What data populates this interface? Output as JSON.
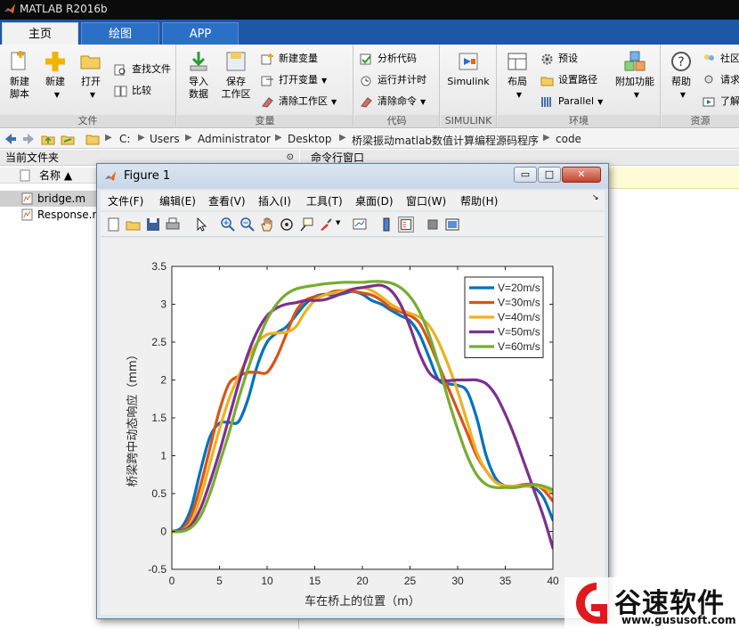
{
  "app": {
    "title": "MATLAB R2016b",
    "accent": "#1c57a8"
  },
  "tabs": [
    {
      "label": "主页",
      "active": true
    },
    {
      "label": "绘图",
      "active": false
    },
    {
      "label": "APP",
      "active": false
    }
  ],
  "ribbon": {
    "file_group": {
      "label": "文件",
      "new_script": "新建\n脚本",
      "new": "新建",
      "open": "打开",
      "find_files": "查找文件",
      "compare": "比较"
    },
    "variable_group": {
      "label": "变量",
      "import_data": "导入\n数据",
      "save_workspace": "保存\n工作区",
      "new_variable": "新建变量",
      "open_variable": "打开变量",
      "clear_workspace": "清除工作区"
    },
    "code_group": {
      "label": "代码",
      "analyze_code": "分析代码",
      "run_and_time": "运行并计时",
      "clear_commands": "清除命令"
    },
    "simulink_group": {
      "label": "SIMULINK",
      "simulink": "Simulink"
    },
    "environment_group": {
      "label": "环境",
      "layout": "布局",
      "preferences": "预设",
      "set_path": "设置路径",
      "parallel": "Parallel",
      "add_ons": "附加功能"
    },
    "resources_group": {
      "label": "资源",
      "help": "帮助",
      "community": "社区",
      "request_support": "请求",
      "learn": "了解"
    }
  },
  "address": {
    "crumbs": [
      "C:",
      "Users",
      "Administrator",
      "Desktop",
      "桥梁振动matlab数值计算编程源码程序",
      "code"
    ]
  },
  "current_folder": {
    "title": "当前文件夹",
    "name_header": "名称 ▲",
    "files": [
      {
        "name": "bridge.m",
        "selected": true
      },
      {
        "name": "Response.m",
        "selected": false
      }
    ]
  },
  "command_window": {
    "title": "命令行窗口"
  },
  "figure": {
    "title": "Figure 1",
    "menus": [
      "文件(F)",
      "编辑(E)",
      "查看(V)",
      "插入(I)",
      "工具(T)",
      "桌面(D)",
      "窗口(W)",
      "帮助(H)"
    ],
    "minimize": "▭",
    "maximize": "□",
    "close": "✕"
  },
  "chart_data": {
    "type": "line",
    "title": "",
    "xlabel": "车在桥上的位置（m）",
    "ylabel": "桥梁跨中动态响应（mm）",
    "xlim": [
      0,
      40
    ],
    "ylim": [
      -0.5,
      3.5
    ],
    "xticks": [
      0,
      5,
      10,
      15,
      20,
      25,
      30,
      35,
      40
    ],
    "yticks": [
      -0.5,
      0,
      0.5,
      1,
      1.5,
      2,
      2.5,
      3,
      3.5
    ],
    "grid": false,
    "legend_position": "top-right",
    "series": [
      {
        "name": "V=20m/s",
        "color": "#0072bd",
        "x": [
          0,
          1,
          2,
          3,
          4,
          5,
          6,
          7,
          8,
          9,
          10,
          11,
          12,
          13,
          14,
          15,
          16,
          17,
          18,
          19,
          20,
          21,
          22,
          23,
          24,
          25,
          26,
          27,
          28,
          29,
          30,
          31,
          32,
          33,
          34,
          35,
          36,
          37,
          38,
          39,
          40
        ],
        "y": [
          0,
          0.05,
          0.3,
          0.8,
          1.25,
          1.43,
          1.44,
          1.45,
          1.75,
          2.2,
          2.5,
          2.62,
          2.7,
          2.85,
          3.0,
          3.1,
          3.13,
          3.12,
          3.14,
          3.17,
          3.13,
          3.05,
          3.0,
          2.92,
          2.85,
          2.78,
          2.6,
          2.3,
          2.0,
          1.95,
          1.93,
          1.85,
          1.5,
          1.0,
          0.7,
          0.6,
          0.58,
          0.6,
          0.58,
          0.45,
          0.15
        ]
      },
      {
        "name": "V=30m/s",
        "color": "#d95319",
        "x": [
          0,
          1,
          2,
          3,
          4,
          5,
          6,
          7,
          8,
          9,
          10,
          11,
          12,
          13,
          14,
          15,
          16,
          17,
          18,
          19,
          20,
          21,
          22,
          23,
          24,
          25,
          26,
          27,
          28,
          29,
          30,
          31,
          32,
          33,
          34,
          35,
          36,
          37,
          38,
          39,
          40
        ],
        "y": [
          0,
          0.02,
          0.2,
          0.6,
          1.1,
          1.6,
          1.95,
          2.05,
          2.1,
          2.1,
          2.1,
          2.3,
          2.6,
          2.9,
          3.05,
          3.1,
          3.12,
          3.17,
          3.18,
          3.17,
          3.15,
          3.12,
          3.05,
          2.95,
          2.9,
          2.85,
          2.75,
          2.5,
          2.2,
          1.9,
          1.6,
          1.3,
          1.0,
          0.8,
          0.65,
          0.6,
          0.6,
          0.62,
          0.62,
          0.55,
          0.4
        ]
      },
      {
        "name": "V=40m/s",
        "color": "#edb120",
        "x": [
          0,
          1,
          2,
          3,
          4,
          5,
          6,
          7,
          8,
          9,
          10,
          11,
          12,
          13,
          14,
          15,
          16,
          17,
          18,
          19,
          20,
          21,
          22,
          23,
          24,
          25,
          26,
          27,
          28,
          29,
          30,
          31,
          32,
          33,
          34,
          35,
          36,
          37,
          38,
          39,
          40
        ],
        "y": [
          0,
          0.01,
          0.12,
          0.45,
          0.9,
          1.35,
          1.75,
          2.05,
          2.3,
          2.5,
          2.6,
          2.62,
          2.63,
          2.7,
          2.9,
          3.05,
          3.12,
          3.15,
          3.18,
          3.2,
          3.22,
          3.18,
          3.1,
          3.0,
          2.93,
          2.88,
          2.83,
          2.72,
          2.5,
          2.2,
          1.85,
          1.45,
          1.05,
          0.8,
          0.65,
          0.6,
          0.6,
          0.6,
          0.6,
          0.58,
          0.5
        ]
      },
      {
        "name": "V=50m/s",
        "color": "#7e2f8e",
        "x": [
          0,
          1,
          2,
          3,
          4,
          5,
          6,
          7,
          8,
          9,
          10,
          11,
          12,
          13,
          14,
          15,
          16,
          17,
          18,
          19,
          20,
          21,
          22,
          23,
          24,
          25,
          26,
          27,
          28,
          29,
          30,
          31,
          32,
          33,
          34,
          35,
          36,
          37,
          38,
          39,
          40
        ],
        "y": [
          0,
          0.01,
          0.08,
          0.3,
          0.65,
          1.05,
          1.5,
          1.95,
          2.35,
          2.65,
          2.85,
          2.95,
          3.0,
          3.02,
          3.05,
          3.05,
          3.06,
          3.1,
          3.15,
          3.2,
          3.22,
          3.24,
          3.25,
          3.18,
          3.0,
          2.7,
          2.35,
          2.1,
          2.0,
          1.99,
          2.0,
          2.0,
          2.0,
          1.95,
          1.8,
          1.55,
          1.25,
          0.9,
          0.55,
          0.2,
          -0.22
        ]
      },
      {
        "name": "V=60m/s",
        "color": "#77ac30",
        "x": [
          0,
          1,
          2,
          3,
          4,
          5,
          6,
          7,
          8,
          9,
          10,
          11,
          12,
          13,
          14,
          15,
          16,
          17,
          18,
          19,
          20,
          21,
          22,
          23,
          24,
          25,
          26,
          27,
          28,
          29,
          30,
          31,
          32,
          33,
          34,
          35,
          36,
          37,
          38,
          39,
          40
        ],
        "y": [
          0,
          0.0,
          0.05,
          0.2,
          0.5,
          0.9,
          1.3,
          1.75,
          2.15,
          2.5,
          2.8,
          3.0,
          3.13,
          3.2,
          3.23,
          3.25,
          3.27,
          3.28,
          3.29,
          3.29,
          3.29,
          3.3,
          3.3,
          3.28,
          3.22,
          3.1,
          2.9,
          2.6,
          2.2,
          1.75,
          1.35,
          1.0,
          0.75,
          0.62,
          0.58,
          0.58,
          0.58,
          0.6,
          0.62,
          0.6,
          0.55
        ]
      }
    ]
  },
  "watermark": {
    "name": "谷速软件",
    "url": "www.gususoft.com",
    "color": "#e0191e"
  }
}
